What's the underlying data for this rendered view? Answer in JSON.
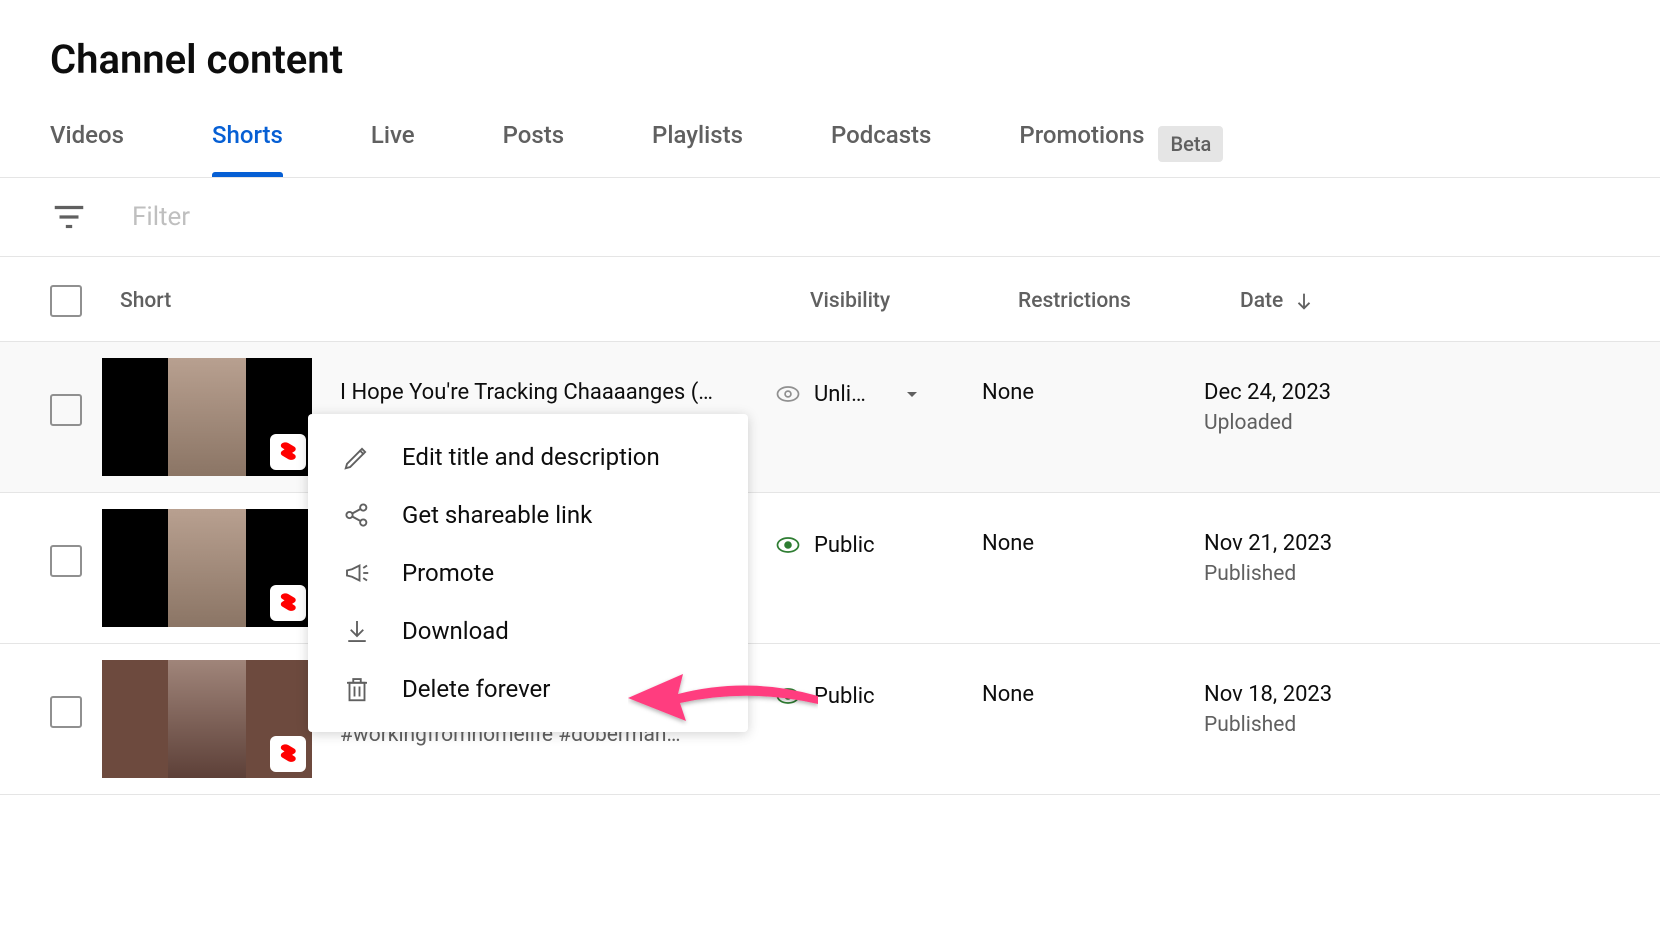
{
  "page_title": "Channel content",
  "tabs": [
    {
      "label": "Videos"
    },
    {
      "label": "Shorts"
    },
    {
      "label": "Live"
    },
    {
      "label": "Posts"
    },
    {
      "label": "Playlists"
    },
    {
      "label": "Podcasts"
    },
    {
      "label": "Promotions"
    }
  ],
  "beta_label": "Beta",
  "filter_placeholder": "Filter",
  "columns": {
    "short": "Short",
    "visibility": "Visibility",
    "restrictions": "Restrictions",
    "date": "Date"
  },
  "rows": [
    {
      "title": "I Hope You're Tracking Chaaaanges (…",
      "visibility": "Unli…",
      "restrictions": "None",
      "date": "Dec 24, 2023",
      "status": "Uploaded"
    },
    {
      "title": "",
      "visibility": "Public",
      "restrictions": "None",
      "date": "Nov 21, 2023",
      "status": "Published"
    },
    {
      "title": "",
      "desc": "Do you have an \"assistant\" too? #workingfromhomelife #doberman…",
      "visibility": "Public",
      "restrictions": "None",
      "date": "Nov 18, 2023",
      "status": "Published"
    }
  ],
  "menu": [
    {
      "label": "Edit title and description"
    },
    {
      "label": "Get shareable link"
    },
    {
      "label": "Promote"
    },
    {
      "label": "Download"
    },
    {
      "label": "Delete forever"
    }
  ]
}
